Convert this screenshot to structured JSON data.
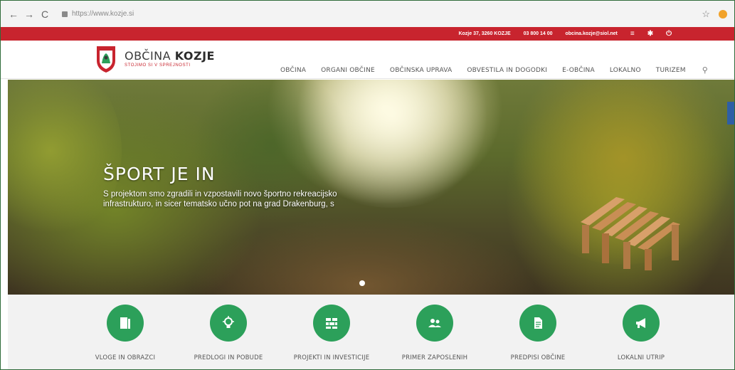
{
  "browser": {
    "back": "←",
    "forward": "→",
    "reload": "C",
    "url": "https://www.kozje.si",
    "star": "☆"
  },
  "topbar": {
    "address": "Kozje 37, 3260 KOZJE",
    "phone": "03 800 14 00",
    "email": "obcina.kozje@siol.net",
    "icons": [
      "menu-icon",
      "settings-icon",
      "power-icon"
    ]
  },
  "header": {
    "brand_prefix": "OBČINA",
    "brand_bold": "KOZJE",
    "brand_sub": "STOJIMO SI V SPREJNOSTI",
    "menu": [
      "OBČINA",
      "ORGANI OBČINE",
      "OBČINSKA UPRAVA",
      "OBVESTILA IN DOGODKI",
      "E-OBČINA",
      "LOKALNO",
      "TURIZEM"
    ]
  },
  "hero": {
    "title": "ŠPORT JE IN",
    "text": "S projektom smo zgradili in vzpostavili novo športno rekreacijsko infrastrukturo, in sicer tematsko učno pot na grad Drakenburg, s"
  },
  "services": [
    {
      "label": "VLOGE IN OBRAZCI",
      "icon": "document-icon"
    },
    {
      "label": "PREDLOGI IN POBUDE",
      "icon": "lightbulb-icon"
    },
    {
      "label": "PROJEKTI IN INVESTICIJE",
      "icon": "bricks-icon"
    },
    {
      "label": "PRIMER ZAPOSLENIH",
      "icon": "people-icon"
    },
    {
      "label": "PREDPISI OBČINE",
      "icon": "file-icon"
    },
    {
      "label": "LOKALNI UTRIP",
      "icon": "megaphone-icon"
    }
  ],
  "colors": {
    "accent_red": "#c8242e",
    "accent_green": "#2ca05a"
  }
}
